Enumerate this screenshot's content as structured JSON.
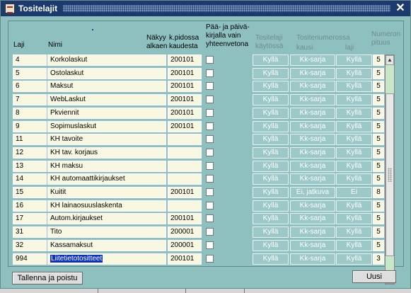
{
  "window": {
    "title": "Tositelajit"
  },
  "headers": {
    "laji": "Laji",
    "nimi": "Nimi",
    "nakyy_1": "Näkyy",
    "nakyy_2": "alkaen",
    "kpidossa_1": "k.pidossa",
    "kpidossa_2": "kaudesta",
    "paa_1": "Pää- ja päivä-",
    "paa_2": "kirjalla vain",
    "paa_3": "yhteenvetona",
    "kaytossa_1": "Tositelaji",
    "kaytossa_2": "käytössä",
    "tositenum_1": "Tositenumerossa",
    "kausi": "kausi",
    "laji2": "laji",
    "numeron_1": "Numeron",
    "numeron_2": "pituus"
  },
  "rows": [
    {
      "laji": "4",
      "nimi": "Korkolaskut",
      "alkaen": "200101",
      "paa": false,
      "kaytossa": "Kyllä",
      "kausi": "Kk-sarja",
      "lajiflag": "Kyllä",
      "pituus": "5"
    },
    {
      "laji": "5",
      "nimi": "Ostolaskut",
      "alkaen": "200101",
      "paa": false,
      "kaytossa": "Kyllä",
      "kausi": "Kk-sarja",
      "lajiflag": "Kyllä",
      "pituus": "5"
    },
    {
      "laji": "6",
      "nimi": "Maksut",
      "alkaen": "200101",
      "paa": false,
      "kaytossa": "Kyllä",
      "kausi": "Kk-sarja",
      "lajiflag": "Kyllä",
      "pituus": "5"
    },
    {
      "laji": "7",
      "nimi": "WebLaskut",
      "alkaen": "200101",
      "paa": false,
      "kaytossa": "Kyllä",
      "kausi": "Kk-sarja",
      "lajiflag": "Kyllä",
      "pituus": "5"
    },
    {
      "laji": "8",
      "nimi": "Pkviennit",
      "alkaen": "200101",
      "paa": false,
      "kaytossa": "Kyllä",
      "kausi": "Kk-sarja",
      "lajiflag": "Kyllä",
      "pituus": "5"
    },
    {
      "laji": "9",
      "nimi": "Sopimuslaskut",
      "alkaen": "200101",
      "paa": false,
      "kaytossa": "Kyllä",
      "kausi": "Kk-sarja",
      "lajiflag": "Kyllä",
      "pituus": "5"
    },
    {
      "laji": "11",
      "nimi": "KH tavoite",
      "alkaen": "",
      "paa": false,
      "kaytossa": "Kyllä",
      "kausi": "Kk-sarja",
      "lajiflag": "Kyllä",
      "pituus": "5"
    },
    {
      "laji": "12",
      "nimi": "KH tav. korjaus",
      "alkaen": "",
      "paa": false,
      "kaytossa": "Kyllä",
      "kausi": "Kk-sarja",
      "lajiflag": "Kyllä",
      "pituus": "5"
    },
    {
      "laji": "13",
      "nimi": "KH maksu",
      "alkaen": "",
      "paa": false,
      "kaytossa": "Kyllä",
      "kausi": "Kk-sarja",
      "lajiflag": "Kyllä",
      "pituus": "5"
    },
    {
      "laji": "14",
      "nimi": "KH automaattikirjaukset",
      "alkaen": "",
      "paa": false,
      "kaytossa": "Kyllä",
      "kausi": "Kk-sarja",
      "lajiflag": "Kyllä",
      "pituus": "5"
    },
    {
      "laji": "15",
      "nimi": "Kuitit",
      "alkaen": "200101",
      "paa": false,
      "kaytossa": "Kyllä",
      "kausi": "Ei, jatkuva",
      "lajiflag": "Ei",
      "pituus": "8"
    },
    {
      "laji": "16",
      "nimi": "KH lainaosuuslaskenta",
      "alkaen": "",
      "paa": false,
      "kaytossa": "Kyllä",
      "kausi": "Kk-sarja",
      "lajiflag": "Kyllä",
      "pituus": "5"
    },
    {
      "laji": "17",
      "nimi": "Autom.kirjaukset",
      "alkaen": "200101",
      "paa": false,
      "kaytossa": "Kyllä",
      "kausi": "Kk-sarja",
      "lajiflag": "Kyllä",
      "pituus": "5"
    },
    {
      "laji": "31",
      "nimi": "Tito",
      "alkaen": "200001",
      "paa": false,
      "kaytossa": "Kyllä",
      "kausi": "Kk-sarja",
      "lajiflag": "Kyllä",
      "pituus": "5"
    },
    {
      "laji": "32",
      "nimi": "Kassamaksut",
      "alkaen": "200001",
      "paa": false,
      "kaytossa": "Kyllä",
      "kausi": "Kk-sarja",
      "lajiflag": "Kyllä",
      "pituus": "5"
    },
    {
      "laji": "994",
      "nimi": "Liitetietotositteet",
      "alkaen": "200101",
      "paa": false,
      "kaytossa": "Kyllä",
      "kausi": "Kk-sarja",
      "lajiflag": "Kyllä",
      "pituus": "3"
    }
  ],
  "buttons": {
    "save": "Tallenna ja poistu",
    "new": "Uusi"
  },
  "colors": {
    "titlebar": "#1b3a6e",
    "window": "#8fc0c0",
    "input": "#f8f8e2",
    "readonly": "#9cc8c8",
    "selection": "#0a30c8"
  },
  "icons": {
    "app": "document-list-icon",
    "close": "close-icon"
  }
}
